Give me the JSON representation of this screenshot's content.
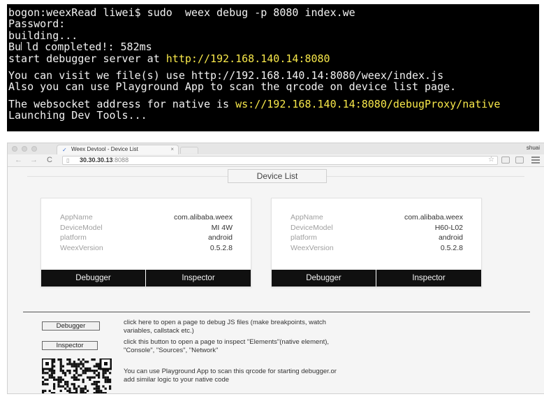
{
  "terminal": {
    "lines": [
      {
        "text": "bogon:weexRead liwei$ sudo  weex debug -p 8080 index.we"
      },
      {
        "text": "Password:"
      },
      {
        "text": "building..."
      },
      {
        "pre": "Bu",
        "post": "ld completed!: 582ms"
      },
      {
        "text": "start debugger server at ",
        "hl": "http://192.168.140.14:8080"
      },
      {
        "text": "You can visit we file(s) use http://192.168.140.14:8080/weex/index.js"
      },
      {
        "text": "Also you can use Playground App to scan the qrcode on device list page."
      },
      {
        "text": "The websocket address for native is ",
        "hl": "ws://192.168.140.14:8080/debugProxy/native"
      },
      {
        "text": "Launching Dev Tools..."
      }
    ],
    "highlight_color": "#f8e84a"
  },
  "browser": {
    "tab_title": "Weex Devtool - Device List",
    "tab_close": "×",
    "user": "shuai",
    "url_host": "30.30.30.13",
    "url_port": ":8088",
    "nav": {
      "back": "←",
      "forward": "→",
      "reload": "C"
    },
    "icons": {
      "tab": "weex-tab-icon",
      "page": "page-icon",
      "star": "star-icon",
      "menu": "hamburger-menu-icon"
    }
  },
  "page": {
    "title": "Device List",
    "devices": [
      {
        "rows": [
          {
            "key": "AppName",
            "value": "com.alibaba.weex"
          },
          {
            "key": "DeviceModel",
            "value": "MI 4W"
          },
          {
            "key": "platform",
            "value": "android"
          },
          {
            "key": "WeexVersion",
            "value": "0.5.2.8"
          }
        ],
        "debugger_label": "Debugger",
        "inspector_label": "Inspector"
      },
      {
        "rows": [
          {
            "key": "AppName",
            "value": "com.alibaba.weex"
          },
          {
            "key": "DeviceModel",
            "value": "H60-L02"
          },
          {
            "key": "platform",
            "value": "android"
          },
          {
            "key": "WeexVersion",
            "value": "0.5.2.8"
          }
        ],
        "debugger_label": "Debugger",
        "inspector_label": "Inspector"
      }
    ],
    "help": {
      "debugger_button": "Debugger",
      "debugger_text_1": "click here to open a page to debug JS files (make breakpoints, watch",
      "debugger_text_2": "variables, callstack etc.)",
      "inspector_button": "Inspector",
      "inspector_text_1": "click this button to open a page to inspect \"Elements\"(native element),",
      "inspector_text_2": "\"Console\", \"Sources\", \"Network\"",
      "qrcode_text_1": "You can use Playground App to scan this qrcode for starting debugger.or",
      "qrcode_text_2": "add similar logic to your native code"
    }
  }
}
